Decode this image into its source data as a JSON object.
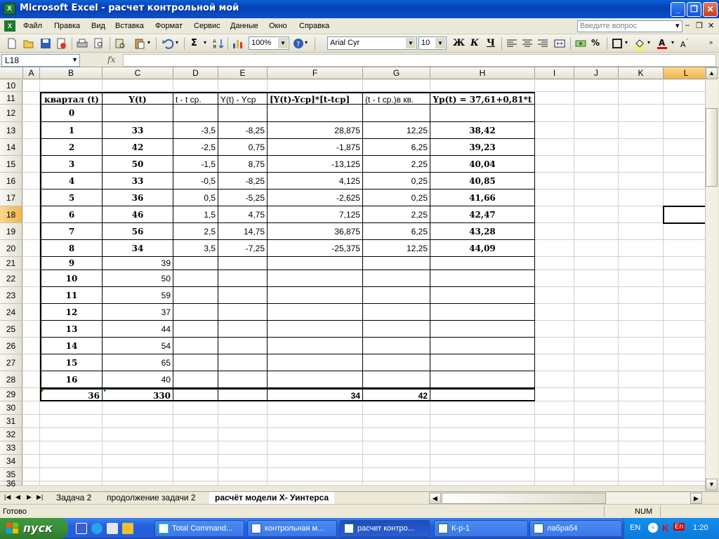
{
  "window": {
    "title": "Microsoft Excel - расчет контрольной мой",
    "app_icon": "excel-icon"
  },
  "menubar": {
    "items": [
      "Файл",
      "Правка",
      "Вид",
      "Вставка",
      "Формат",
      "Сервис",
      "Данные",
      "Окно",
      "Справка"
    ],
    "help_placeholder": "Введите вопрос"
  },
  "toolbar": {
    "zoom": "100%",
    "font_name": "Arial Cyr",
    "font_size": "10",
    "bold": "Ж",
    "italic": "К",
    "underline": "Ч",
    "sum": "Σ",
    "percent": "%"
  },
  "formula_bar": {
    "cell_ref": "L18",
    "fx": "fx",
    "content": ""
  },
  "grid": {
    "columns": [
      "A",
      "B",
      "C",
      "D",
      "E",
      "F",
      "G",
      "H",
      "I",
      "J",
      "K",
      "L"
    ],
    "selected_column": "L",
    "rows": [
      10,
      11,
      12,
      13,
      14,
      15,
      16,
      17,
      18,
      19,
      20,
      21,
      22,
      23,
      24,
      25,
      26,
      27,
      28,
      29,
      30,
      31,
      32,
      33,
      34,
      35,
      36
    ],
    "selected_row": 18,
    "headers": {
      "B": "квартал (t)",
      "C": "Y(t)",
      "D": "t - t ср.",
      "E": "Y(t) - Yср",
      "F": "[Y(t)-Yср]*[t-tср]",
      "G": "(t - t ср.)в кв.",
      "H": "Yр(t) = 37,61+0,81*t"
    },
    "data_rows": [
      {
        "row": 12,
        "B": "0",
        "C": "",
        "D": "",
        "E": "",
        "F": "",
        "G": "",
        "H": ""
      },
      {
        "row": 13,
        "B": "1",
        "C": "33",
        "D": "-3,5",
        "E": "-8,25",
        "F": "28,875",
        "G": "12,25",
        "H": "38,42"
      },
      {
        "row": 14,
        "B": "2",
        "C": "42",
        "D": "-2,5",
        "E": "0,75",
        "F": "-1,875",
        "G": "6,25",
        "H": "39,23"
      },
      {
        "row": 15,
        "B": "3",
        "C": "50",
        "D": "-1,5",
        "E": "8,75",
        "F": "-13,125",
        "G": "2,25",
        "H": "40,04"
      },
      {
        "row": 16,
        "B": "4",
        "C": "33",
        "D": "-0,5",
        "E": "-8,25",
        "F": "4,125",
        "G": "0,25",
        "H": "40,85"
      },
      {
        "row": 17,
        "B": "5",
        "C": "36",
        "D": "0,5",
        "E": "-5,25",
        "F": "-2,625",
        "G": "0,25",
        "H": "41,66"
      },
      {
        "row": 18,
        "B": "6",
        "C": "46",
        "D": "1,5",
        "E": "4,75",
        "F": "7,125",
        "G": "2,25",
        "H": "42,47"
      },
      {
        "row": 19,
        "B": "7",
        "C": "56",
        "D": "2,5",
        "E": "14,75",
        "F": "36,875",
        "G": "6,25",
        "H": "43,28"
      },
      {
        "row": 20,
        "B": "8",
        "C": "34",
        "D": "3,5",
        "E": "-7,25",
        "F": "-25,375",
        "G": "12,25",
        "H": "44,09"
      },
      {
        "row": 21,
        "B": "9",
        "C": "39",
        "D": "",
        "E": "",
        "F": "",
        "G": "",
        "H": ""
      },
      {
        "row": 22,
        "B": "10",
        "C": "50",
        "D": "",
        "E": "",
        "F": "",
        "G": "",
        "H": ""
      },
      {
        "row": 23,
        "B": "11",
        "C": "59",
        "D": "",
        "E": "",
        "F": "",
        "G": "",
        "H": ""
      },
      {
        "row": 24,
        "B": "12",
        "C": "37",
        "D": "",
        "E": "",
        "F": "",
        "G": "",
        "H": ""
      },
      {
        "row": 25,
        "B": "13",
        "C": "44",
        "D": "",
        "E": "",
        "F": "",
        "G": "",
        "H": ""
      },
      {
        "row": 26,
        "B": "14",
        "C": "54",
        "D": "",
        "E": "",
        "F": "",
        "G": "",
        "H": ""
      },
      {
        "row": 27,
        "B": "15",
        "C": "65",
        "D": "",
        "E": "",
        "F": "",
        "G": "",
        "H": ""
      },
      {
        "row": 28,
        "B": "16",
        "C": "40",
        "D": "",
        "E": "",
        "F": "",
        "G": "",
        "H": ""
      }
    ],
    "totals": {
      "row": 29,
      "B": "36",
      "C": "330",
      "D": "",
      "E": "",
      "F": "34",
      "G": "42",
      "H": ""
    }
  },
  "sheet_tabs": {
    "tabs": [
      "Задача 2",
      "продолжение задачи 2",
      "расчёт модели Х- Уинтерса"
    ],
    "active": "расчёт модели Х- Уинтерса"
  },
  "status": {
    "ready": "Готово",
    "num": "NUM"
  },
  "taskbar": {
    "start": "пуск",
    "tasks": [
      "Total Command...",
      "контрольная м...",
      "расчет контро...",
      "К-р-1",
      "лабраб4"
    ],
    "active_task": "расчет контро...",
    "lang": "EN",
    "tray_lang": "En",
    "clock": "1:20"
  },
  "colors": {
    "titlebar": "#0a4fc8",
    "selection_header": "#f2b64c",
    "start_button": "#3c8d3c",
    "taskbar": "#245edb"
  }
}
